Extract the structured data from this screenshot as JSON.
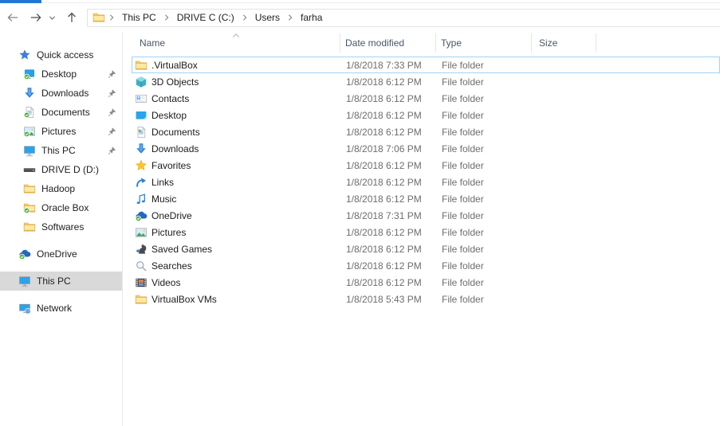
{
  "colors": {
    "accent_strip": "#2277d4",
    "selection_border": "#9fd3f7",
    "sidebar_selected_bg": "#d9d9d9",
    "header_text": "#46586d",
    "secondary_text": "#6d6d6d",
    "separator": "#e5e5e5"
  },
  "toolbar": {
    "breadcrumb": {
      "icon": "folder",
      "items": [
        {
          "label": "This PC"
        },
        {
          "label": "DRIVE C (C:)"
        },
        {
          "label": "Users"
        },
        {
          "label": "farha"
        }
      ]
    }
  },
  "sidebar": {
    "items": [
      {
        "label": "Quick access",
        "icon": "quick-access-star",
        "level": 0,
        "pinned": false,
        "selected": false,
        "gap_before": false
      },
      {
        "label": "Desktop",
        "icon": "desktop-sync",
        "level": 1,
        "pinned": true,
        "selected": false,
        "gap_before": false
      },
      {
        "label": "Downloads",
        "icon": "downloads-arrow",
        "level": 1,
        "pinned": true,
        "selected": false,
        "gap_before": false
      },
      {
        "label": "Documents",
        "icon": "documents-sync",
        "level": 1,
        "pinned": true,
        "selected": false,
        "gap_before": false
      },
      {
        "label": "Pictures",
        "icon": "pictures-sync",
        "level": 1,
        "pinned": true,
        "selected": false,
        "gap_before": false
      },
      {
        "label": "This PC",
        "icon": "this-pc",
        "level": 1,
        "pinned": true,
        "selected": false,
        "gap_before": false
      },
      {
        "label": "DRIVE D (D:)",
        "icon": "hard-drive",
        "level": 1,
        "pinned": false,
        "selected": false,
        "gap_before": false
      },
      {
        "label": "Hadoop",
        "icon": "folder",
        "level": 1,
        "pinned": false,
        "selected": false,
        "gap_before": false
      },
      {
        "label": "Oracle Box",
        "icon": "folder-sync",
        "level": 1,
        "pinned": false,
        "selected": false,
        "gap_before": false
      },
      {
        "label": "Softwares",
        "icon": "folder",
        "level": 1,
        "pinned": false,
        "selected": false,
        "gap_before": false
      },
      {
        "label": "OneDrive",
        "icon": "onedrive-cloud",
        "level": 0,
        "pinned": false,
        "selected": false,
        "gap_before": true
      },
      {
        "label": "This PC",
        "icon": "this-pc",
        "level": 0,
        "pinned": false,
        "selected": true,
        "gap_before": true
      },
      {
        "label": "Network",
        "icon": "network-pc",
        "level": 0,
        "pinned": false,
        "selected": false,
        "gap_before": true
      }
    ]
  },
  "list": {
    "columns": [
      {
        "label": "Name",
        "sort": "asc"
      },
      {
        "label": "Date modified"
      },
      {
        "label": "Type"
      },
      {
        "label": "Size"
      }
    ],
    "rows": [
      {
        "name": ".VirtualBox",
        "icon": "folder",
        "date": "1/8/2018 7:33 PM",
        "type": "File folder",
        "size": "",
        "selected": true
      },
      {
        "name": "3D Objects",
        "icon": "cube",
        "date": "1/8/2018 6:12 PM",
        "type": "File folder",
        "size": "",
        "selected": false
      },
      {
        "name": "Contacts",
        "icon": "contacts",
        "date": "1/8/2018 6:12 PM",
        "type": "File folder",
        "size": "",
        "selected": false
      },
      {
        "name": "Desktop",
        "icon": "desktop-item",
        "date": "1/8/2018 6:12 PM",
        "type": "File folder",
        "size": "",
        "selected": false
      },
      {
        "name": "Documents",
        "icon": "documents-item",
        "date": "1/8/2018 6:12 PM",
        "type": "File folder",
        "size": "",
        "selected": false
      },
      {
        "name": "Downloads",
        "icon": "downloads-arrow",
        "date": "1/8/2018 7:06 PM",
        "type": "File folder",
        "size": "",
        "selected": false
      },
      {
        "name": "Favorites",
        "icon": "star-gold",
        "date": "1/8/2018 6:12 PM",
        "type": "File folder",
        "size": "",
        "selected": false
      },
      {
        "name": "Links",
        "icon": "links",
        "date": "1/8/2018 6:12 PM",
        "type": "File folder",
        "size": "",
        "selected": false
      },
      {
        "name": "Music",
        "icon": "music",
        "date": "1/8/2018 6:12 PM",
        "type": "File folder",
        "size": "",
        "selected": false
      },
      {
        "name": "OneDrive",
        "icon": "onedrive-cloud",
        "date": "1/8/2018 7:31 PM",
        "type": "File folder",
        "size": "",
        "selected": false
      },
      {
        "name": "Pictures",
        "icon": "pictures-item",
        "date": "1/8/2018 6:12 PM",
        "type": "File folder",
        "size": "",
        "selected": false
      },
      {
        "name": "Saved Games",
        "icon": "saved-games",
        "date": "1/8/2018 6:12 PM",
        "type": "File folder",
        "size": "",
        "selected": false
      },
      {
        "name": "Searches",
        "icon": "searches",
        "date": "1/8/2018 6:12 PM",
        "type": "File folder",
        "size": "",
        "selected": false
      },
      {
        "name": "Videos",
        "icon": "videos",
        "date": "1/8/2018 6:12 PM",
        "type": "File folder",
        "size": "",
        "selected": false
      },
      {
        "name": "VirtualBox VMs",
        "icon": "folder",
        "date": "1/8/2018 5:43 PM",
        "type": "File folder",
        "size": "",
        "selected": false
      }
    ]
  }
}
